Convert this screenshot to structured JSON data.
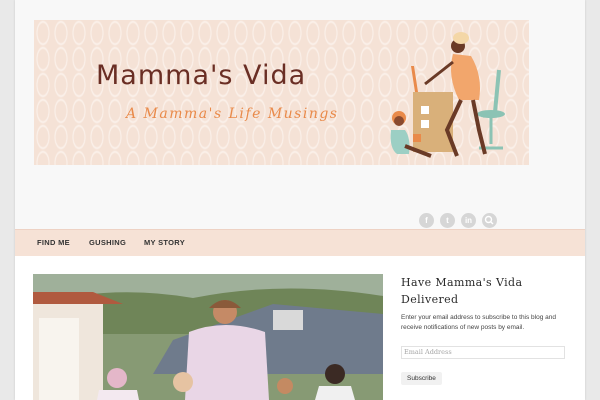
{
  "banner": {
    "title": "Mamma's Vida",
    "subtitle": "A Mamma's Life Musings"
  },
  "social_icons": [
    "facebook-icon",
    "twitter-icon",
    "linkedin-icon",
    "search-icon"
  ],
  "nav": {
    "items": [
      {
        "label": "FIND ME"
      },
      {
        "label": "GUSHING"
      },
      {
        "label": "MY STORY"
      }
    ]
  },
  "sidebar": {
    "title": "Have Mamma's Vida Delivered",
    "description": "Enter your email address to subscribe to this blog and receive notifications of new posts by email.",
    "email_placeholder": "Email Address",
    "subscribe_label": "Subscribe"
  },
  "colors": {
    "banner_bg": "#f5e2d6",
    "title": "#6a2e24",
    "subtitle": "#e98a4a",
    "nav_bg": "#f6e2d6"
  }
}
